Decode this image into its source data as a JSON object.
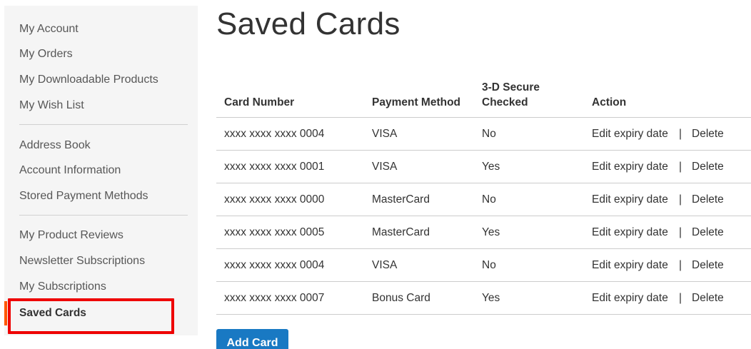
{
  "sidebar": {
    "items": [
      {
        "label": "My Account"
      },
      {
        "label": "My Orders"
      },
      {
        "label": "My Downloadable Products"
      },
      {
        "label": "My Wish List"
      },
      {
        "label": "Address Book"
      },
      {
        "label": "Account Information"
      },
      {
        "label": "Stored Payment Methods"
      },
      {
        "label": "My Product Reviews"
      },
      {
        "label": "Newsletter Subscriptions"
      },
      {
        "label": "My Subscriptions"
      },
      {
        "label": "Saved Cards"
      }
    ],
    "current": "Saved Cards"
  },
  "page": {
    "title": "Saved Cards"
  },
  "table": {
    "headers": {
      "card_number": "Card Number",
      "payment_method": "Payment Method",
      "secure_line1": "3-D Secure",
      "secure_line2": "Checked",
      "action": "Action"
    },
    "rows": [
      {
        "card": "xxxx xxxx xxxx 0004",
        "method": "VISA",
        "secure": "No",
        "edit": "Edit expiry date",
        "sep": "|",
        "delete": "Delete"
      },
      {
        "card": "xxxx xxxx xxxx 0001",
        "method": "VISA",
        "secure": "Yes",
        "edit": "Edit expiry date",
        "sep": "|",
        "delete": "Delete"
      },
      {
        "card": "xxxx xxxx xxxx 0000",
        "method": "MasterCard",
        "secure": "No",
        "edit": "Edit expiry date",
        "sep": "|",
        "delete": "Delete"
      },
      {
        "card": "xxxx xxxx xxxx 0005",
        "method": "MasterCard",
        "secure": "Yes",
        "edit": "Edit expiry date",
        "sep": "|",
        "delete": "Delete"
      },
      {
        "card": "xxxx xxxx xxxx 0004",
        "method": "VISA",
        "secure": "No",
        "edit": "Edit expiry date",
        "sep": "|",
        "delete": "Delete"
      },
      {
        "card": "xxxx xxxx xxxx 0007",
        "method": "Bonus Card",
        "secure": "Yes",
        "edit": "Edit expiry date",
        "sep": "|",
        "delete": "Delete"
      }
    ]
  },
  "actions": {
    "add_card": "Add Card"
  },
  "colors": {
    "link": "#1979c3",
    "delete": "#d10029",
    "button": "#1979c3",
    "highlight": "#ee0000",
    "current_marker": "#ff5501"
  }
}
